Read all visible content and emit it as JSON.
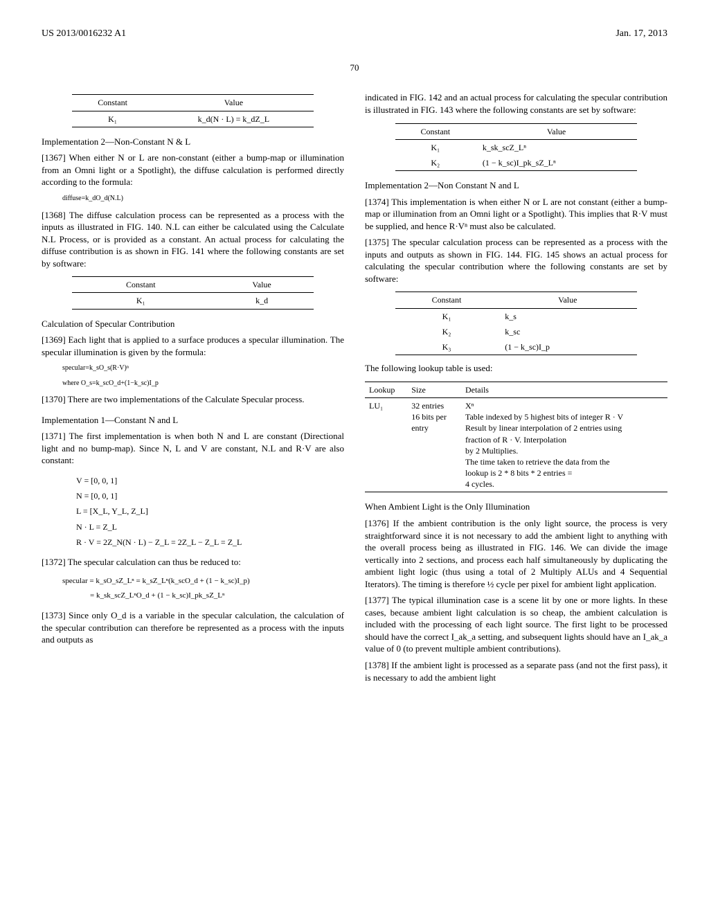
{
  "header": {
    "left": "US 2013/0016232 A1",
    "right": "Jan. 17, 2013"
  },
  "page_number": "70",
  "left_col": {
    "table1": {
      "h1": "Constant",
      "h2": "Value",
      "r1c1": "K₁",
      "r1c2": "k_d(N · L) = k_dZ_L"
    },
    "subhead1": "Implementation 2—Non-Constant N & L",
    "p1367": "[1367]  When either N or L are non-constant (either a bump-map or illumination from an Omni light or a Spotlight), the diffuse calculation is performed directly according to the formula:",
    "formula1": "diffuse=k_dO_d(N.L)",
    "p1368": "[1368]  The diffuse calculation process can be represented as a process with the inputs as illustrated in FIG. 140. N.L can either be calculated using the Calculate N.L Process, or is provided as a constant. An actual process for calculating the diffuse contribution is as shown in FIG. 141 where the following constants are set by software:",
    "table2": {
      "h1": "Constant",
      "h2": "Value",
      "r1c1": "K₁",
      "r1c2": "k_d"
    },
    "subhead2": "Calculation of Specular Contribution",
    "p1369": "[1369]  Each light that is applied to a surface produces a specular illumination. The specular illumination is given by the formula:",
    "formula2": "specular=k_sO_s(R·V)ⁿ",
    "formula3": "where O_s=k_scO_d+(1−k_sc)I_p",
    "p1370": "[1370]  There are two implementations of the Calculate Specular process.",
    "subhead3": "Implementation 1—Constant N and L",
    "p1371": "[1371]  The first implementation is when both N and L are constant (Directional light and no bump-map). Since N, L and V are constant, N.L and R·V are also constant:",
    "vblock": {
      "l1": "V = [0, 0, 1]",
      "l2": "N = [0, 0, 1]",
      "l3": "L = [X_L, Y_L, Z_L]",
      "l4": "N · L = Z_L",
      "l5": "R · V = 2Z_N(N · L) − Z_L = 2Z_L − Z_L = Z_L"
    },
    "p1372": "[1372]  The specular calculation can thus be reduced to:",
    "spec_block": {
      "l1": "specular = k_sO_sZ_Lⁿ = k_sZ_Lⁿ(k_scO_d + (1 − k_sc)I_p)",
      "l2": "= k_sk_scZ_LⁿO_d + (1 − k_sc)I_pk_sZ_Lⁿ"
    },
    "p1373": "[1373]  Since only O_d is a variable in the specular calculation, the calculation of the specular contribution can therefore be represented as a process with the inputs and outputs as"
  },
  "right_col": {
    "p_top": "indicated in FIG. 142 and an actual process for calculating the specular contribution is illustrated in FIG. 143 where the following constants are set by software:",
    "table3": {
      "h1": "Constant",
      "h2": "Value",
      "r1c1": "K₁",
      "r1c2": "k_sk_scZ_Lⁿ",
      "r2c1": "K₂",
      "r2c2": "(1 − k_sc)I_pk_sZ_Lⁿ"
    },
    "subhead4": "Implementation 2—Non Constant N and L",
    "p1374": "[1374]  This implementation is when either N or L are not constant (either a bump-map or illumination from an Omni light or a Spotlight). This implies that R·V must be supplied, and hence R·Vⁿ must also be calculated.",
    "p1375": "[1375]  The specular calculation process can be represented as a process with the inputs and outputs as shown in FIG. 144. FIG. 145 shows an actual process for calculating the specular contribution where the following constants are set by software:",
    "table4": {
      "h1": "Constant",
      "h2": "Value",
      "r1c1": "K₁",
      "r1c2": "k_s",
      "r2c1": "K₂",
      "r2c2": "k_sc",
      "r3c1": "K₃",
      "r3c2": "(1 − k_sc)I_p"
    },
    "p_lookup": "The following lookup table is used:",
    "lookup": {
      "h1": "Lookup",
      "h2": "Size",
      "h3": "Details",
      "r1c1": "LU₁",
      "r1c2": "32 entries\n16 bits per\nentry",
      "r1c3": "Xⁿ\nTable indexed by 5 highest bits of integer R · V\nResult by linear interpolation of 2 entries using\nfraction of R · V. Interpolation\nby 2 Multiplies.\nThe time taken to retrieve the data from the\nlookup is 2 * 8 bits * 2 entries =\n4 cycles."
    },
    "subhead5": "When Ambient Light is the Only Illumination",
    "p1376": "[1376]  If the ambient contribution is the only light source, the process is very straightforward since it is not necessary to add the ambient light to anything with the overall process being as illustrated in FIG. 146. We can divide the image vertically into 2 sections, and process each half simultaneously by duplicating the ambient light logic (thus using a total of 2 Multiply ALUs and 4 Sequential Iterators). The timing is therefore ½ cycle per pixel for ambient light application.",
    "p1377": "[1377]  The typical illumination case is a scene lit by one or more lights. In these cases, because ambient light calculation is so cheap, the ambient calculation is included with the processing of each light source. The first light to be processed should have the correct I_ak_a setting, and subsequent lights should have an I_ak_a value of 0 (to prevent multiple ambient contributions).",
    "p1378": "[1378]  If the ambient light is processed as a separate pass (and not the first pass), it is necessary to add the ambient light"
  }
}
